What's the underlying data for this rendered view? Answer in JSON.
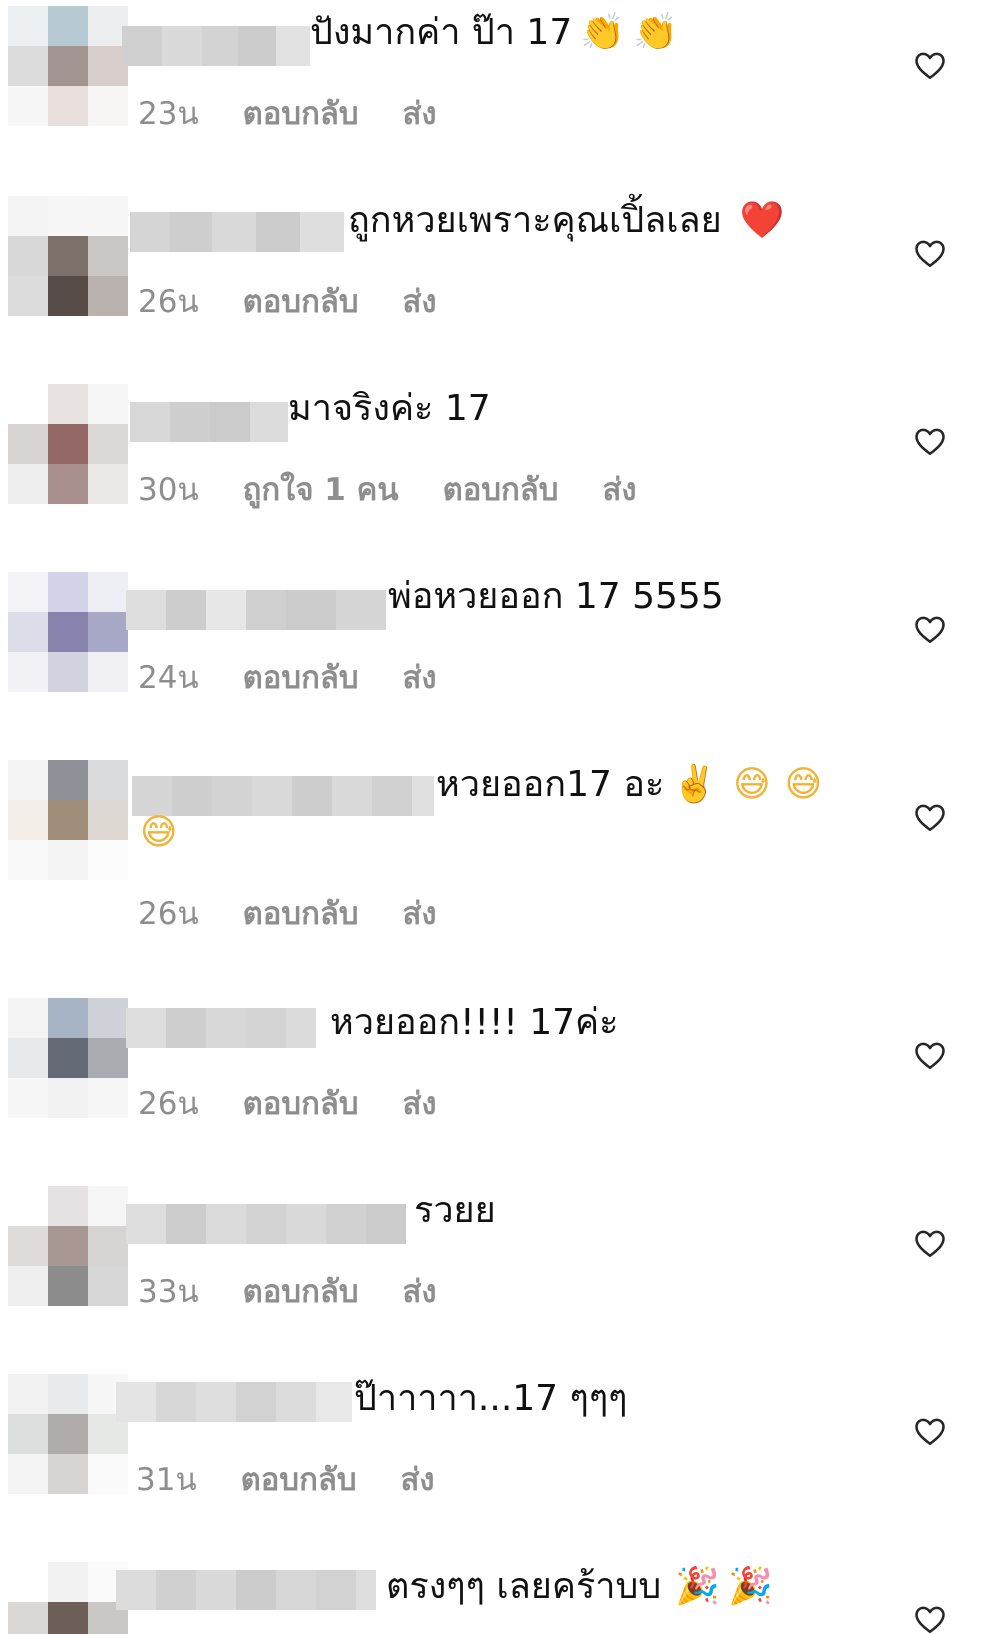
{
  "icons": {
    "heart": "heart-outline-icon",
    "clap": "clapping-hands-icon",
    "red_heart": "red-heart-icon",
    "victory": "victory-hand-icon",
    "grin_sweat": "grinning-sweat-face-icon",
    "party": "party-popper-icon"
  },
  "colors": {
    "meta_text": "#8e8e8e",
    "text": "#111111",
    "heart_stroke": "#262626"
  },
  "actions": {
    "reply": "ตอบกลับ",
    "send": "ส่ง"
  },
  "comments": [
    {
      "text": "ปังมากค่า ป๊า 17",
      "emoji": [
        "👏",
        "👏"
      ],
      "time": "23น",
      "likes": ""
    },
    {
      "text": "ถูกหวยเพราะคุณเปิ้ลเลย",
      "emoji": [
        "❤️"
      ],
      "time": "26น",
      "likes": ""
    },
    {
      "text": "มาจริงค่ะ 17",
      "emoji": [],
      "time": "30น",
      "likes": "ถูกใจ 1 คน"
    },
    {
      "text": "พ่อหวยออก 17 5555",
      "emoji": [],
      "time": "24น",
      "likes": ""
    },
    {
      "text": "หวยออก17 อะ",
      "emoji": [
        "✌️",
        "😅",
        "😅",
        "😅"
      ],
      "time": "26น",
      "likes": ""
    },
    {
      "text": "หวยออก!!!! 17ค่ะ",
      "emoji": [],
      "time": "26น",
      "likes": ""
    },
    {
      "text": "รวยย",
      "emoji": [],
      "time": "33น",
      "likes": ""
    },
    {
      "text": "ป๊าาาาา...17 ๆๆๆ",
      "emoji": [],
      "time": "31น",
      "likes": ""
    },
    {
      "text": "ตรงๆๆ เลยคร้าบบ",
      "emoji": [
        "🎉",
        "🎉"
      ],
      "time": "",
      "likes": ""
    }
  ]
}
